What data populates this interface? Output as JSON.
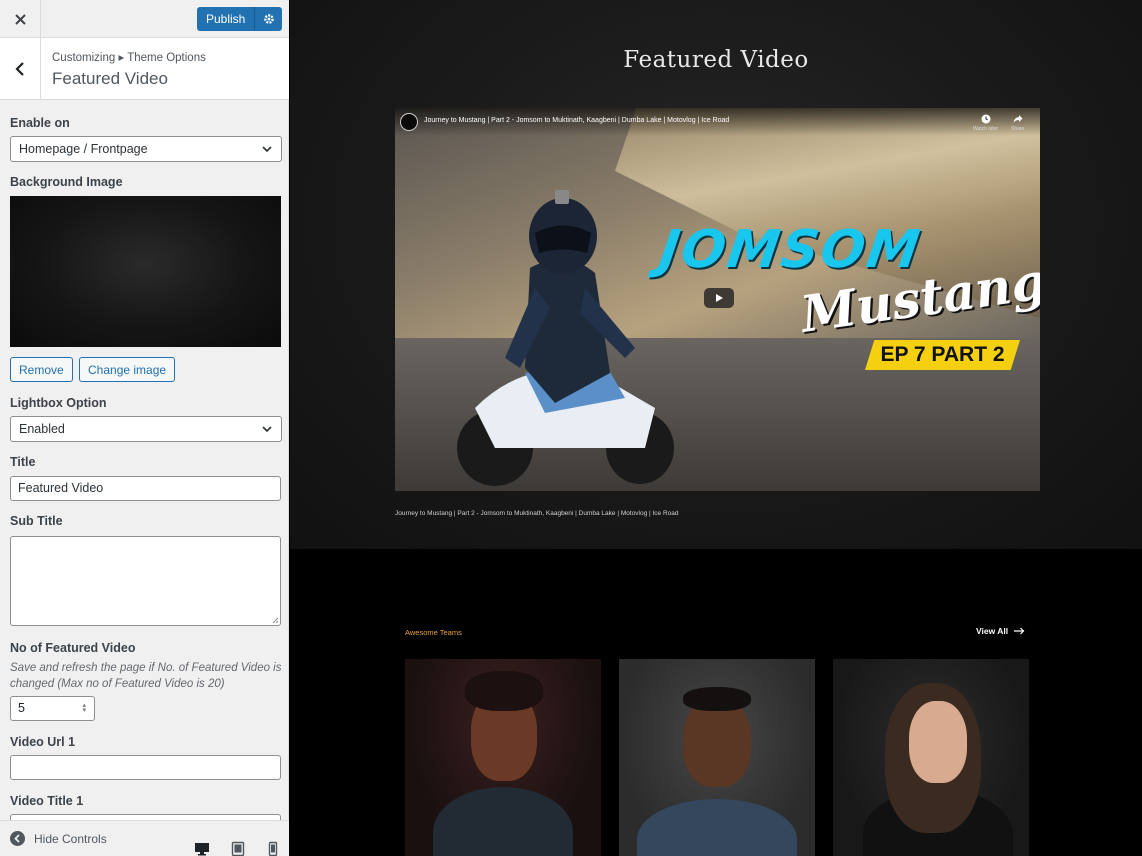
{
  "topbar": {
    "close_icon": "close-icon",
    "publish_label": "Publish",
    "gear_icon": "gear-icon"
  },
  "section": {
    "breadcrumb": "Customizing ▸ Theme Options",
    "title": "Featured Video"
  },
  "controls": {
    "enable_on": {
      "label": "Enable on",
      "value": "Homepage / Frontpage"
    },
    "background_image": {
      "label": "Background Image",
      "remove_label": "Remove",
      "change_label": "Change image"
    },
    "lightbox": {
      "label": "Lightbox Option",
      "value": "Enabled"
    },
    "title": {
      "label": "Title",
      "value": "Featured Video"
    },
    "sub_title": {
      "label": "Sub Title",
      "value": ""
    },
    "count": {
      "label": "No of Featured Video",
      "help": "Save and refresh the page if No. of Featured Video is changed (Max no of Featured Video is 20)",
      "value": "5"
    },
    "video_url_1": {
      "label": "Video Url 1",
      "value": ""
    },
    "video_title_1": {
      "label": "Video Title 1"
    }
  },
  "footer": {
    "hide_controls_label": "Hide Controls",
    "devices": [
      "desktop-icon",
      "tablet-icon",
      "mobile-icon"
    ]
  },
  "preview": {
    "section_title": "Featured Video",
    "video": {
      "bar_title": "Journey to Mustang | Part 2 - Jomsom to Muktinath, Kaagbeni | Dumba Lake | Motovlog | Ice Road",
      "watch_later": "Watch later",
      "share": "Share",
      "thumb_line1": "JOMSOM",
      "thumb_line2": "Mustang",
      "thumb_badge": "EP 7 PART 2"
    },
    "video_caption": "Journey to Mustang | Part 2 - Jomsom to Muktinath, Kaagbeni | Dumba Lake | Motovlog | Ice Road",
    "team_kicker": "Awesome Teams",
    "view_all": "View All"
  }
}
